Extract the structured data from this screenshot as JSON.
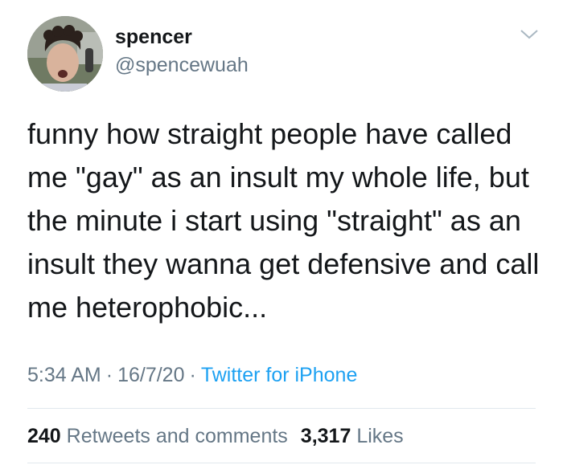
{
  "user": {
    "display_name": "spencer",
    "handle": "@spencewuah"
  },
  "tweet": {
    "lines": [
      "funny how straight people have called",
      "me \"gay\" as an insult my whole life, but",
      "the minute i start using \"straight\" as an",
      "insult they wanna get defensive and call",
      "me heterophobic..."
    ]
  },
  "meta": {
    "time": "5:34 AM",
    "separator": "·",
    "date": "16/7/20",
    "source": "Twitter for iPhone"
  },
  "stats": {
    "retweets_count": "240",
    "retweets_label": "Retweets and comments",
    "likes_count": "3,317",
    "likes_label": "Likes"
  },
  "icons": {
    "menu": "chevron-down-icon"
  },
  "colors": {
    "text": "#14171a",
    "secondary": "#657786",
    "link": "#1da1f2",
    "divider": "#e1e8ed"
  }
}
